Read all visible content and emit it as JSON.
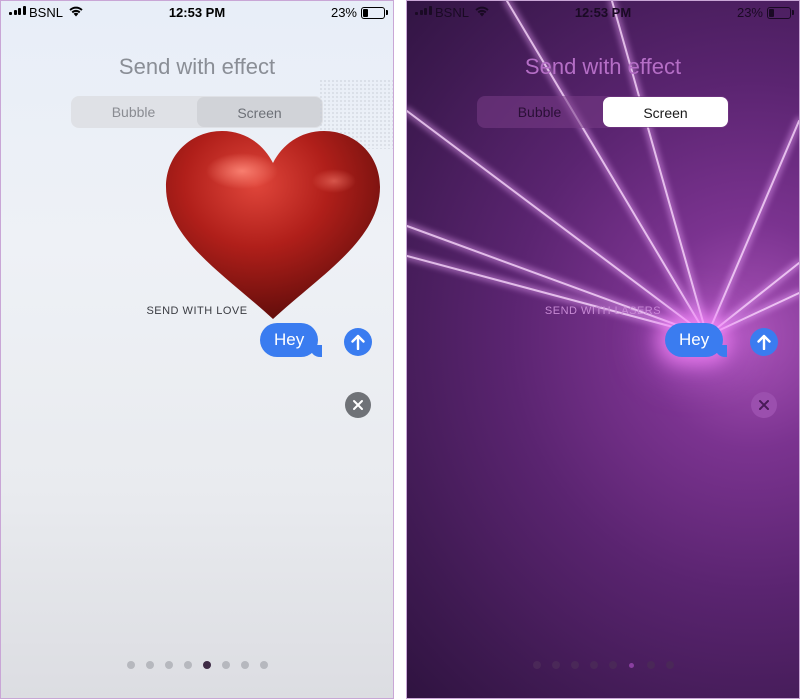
{
  "status_bar": {
    "carrier": "BSNL",
    "time": "12:53 PM",
    "battery_percent": "23%"
  },
  "screens": [
    {
      "title": "Send with effect",
      "tabs": [
        {
          "label": "Bubble",
          "active": false
        },
        {
          "label": "Screen",
          "active": true
        }
      ],
      "effect_label": "SEND WITH LOVE",
      "message": "Hey",
      "page_dots_count": 8,
      "active_dot_index": 4,
      "effect_icon": "heart"
    },
    {
      "title": "Send with effect",
      "tabs": [
        {
          "label": "Bubble",
          "active": false
        },
        {
          "label": "Screen",
          "active": true
        }
      ],
      "effect_label": "SEND WITH LASERS",
      "message": "Hey",
      "page_dots_count": 8,
      "active_dot_index": 5,
      "effect_icon": "lasers"
    }
  ],
  "icons": {
    "send": "arrow-up-icon",
    "close": "close-icon",
    "wifi": "wifi-icon",
    "signal": "signal-icon",
    "battery": "battery-icon"
  },
  "colors": {
    "accent_blue": "#3a7cf0",
    "heart_red": "#b01f1a",
    "laser_purple": "#7b3390"
  }
}
